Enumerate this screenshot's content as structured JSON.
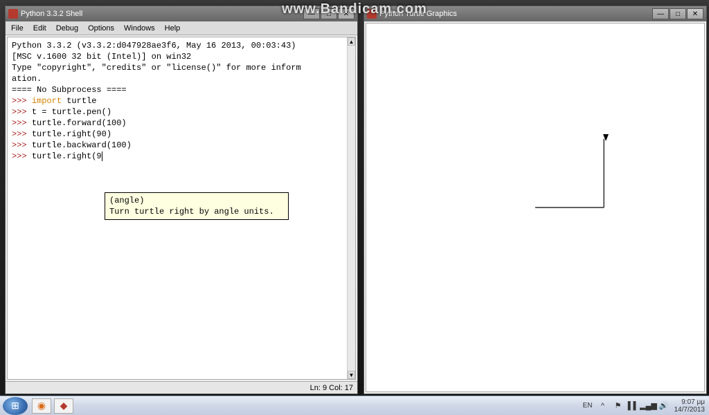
{
  "watermark": "www.Bandicam.com",
  "shell": {
    "title": "Python 3.3.2 Shell",
    "menu": [
      "File",
      "Edit",
      "Debug",
      "Options",
      "Windows",
      "Help"
    ],
    "banner_line1": "Python 3.3.2 (v3.3.2:d047928ae3f6, May 16 2013, 00:03:43)",
    "banner_line2": "[MSC v.1600 32 bit (Intel)] on win32",
    "banner_line3": "Type \"copyright\", \"credits\" or \"license()\" for more inform",
    "banner_line4": "ation.",
    "nosub": "==== No Subprocess ====",
    "prompt": ">>>",
    "lines": {
      "l1_kw": "import",
      "l1_rest": " turtle",
      "l2": "t = turtle.pen()",
      "l3": "turtle.forward(100)",
      "l4": "turtle.right(90)",
      "l5": "turtle.backward(100)",
      "l6": "turtle.right(9"
    },
    "calltip_sig": "(angle)",
    "calltip_doc": "Turn turtle right by angle units.",
    "status_ln": "Ln: 9",
    "status_col": "Col: 17"
  },
  "turtle_window": {
    "title": "Python Turtle Graphics"
  },
  "taskbar": {
    "lang": "EN",
    "time": "9:07 μμ",
    "date": "14/7/2013"
  }
}
